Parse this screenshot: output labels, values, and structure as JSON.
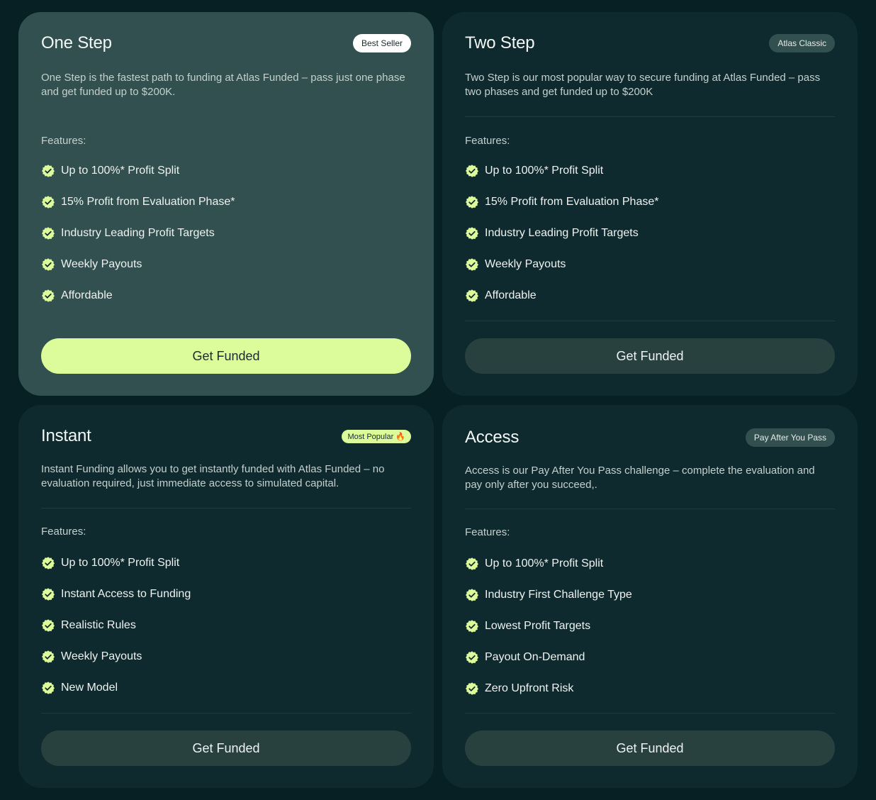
{
  "colors": {
    "background": "#062024",
    "card": "#0f2a2e",
    "card_featured": "#31504f",
    "accent_lime": "#dcfb9b",
    "button_dark": "#28413f"
  },
  "icons": {
    "feature_check": "badge-check-icon",
    "fire": "fire-icon"
  },
  "plans": [
    {
      "title": "One Step",
      "badge": "Best Seller",
      "description": "One Step is the fastest path to funding at Atlas Funded – pass just one phase and get funded up to $200K.",
      "features_label": "Features:",
      "features": [
        "Up to 100%* Profit Split",
        "15% Profit from Evaluation Phase*",
        "Industry Leading Profit Targets",
        "Weekly Payouts",
        "Affordable"
      ],
      "cta": "Get Funded"
    },
    {
      "title": "Two Step",
      "badge": "Atlas Classic",
      "description": "Two Step is our most popular way to secure funding at Atlas Funded – pass two phases and get funded up to $200K",
      "features_label": "Features:",
      "features": [
        "Up to 100%* Profit Split",
        "15% Profit from Evaluation Phase*",
        "Industry Leading Profit Targets",
        "Weekly Payouts",
        "Affordable"
      ],
      "cta": "Get Funded"
    },
    {
      "title": "Instant",
      "badge": "Most Popular 🔥",
      "description": "Instant Funding allows you to get instantly funded with Atlas Funded – no evaluation required, just immediate access to simulated capital.",
      "features_label": "Features:",
      "features": [
        "Up to 100%* Profit Split",
        "Instant Access to Funding",
        "Realistic Rules",
        "Weekly Payouts",
        "New Model"
      ],
      "cta": "Get Funded"
    },
    {
      "title": "Access",
      "badge": "Pay After You Pass",
      "description": "Access is our Pay After You Pass challenge – complete the evaluation and pay only after you succeed,.",
      "features_label": "Features:",
      "features": [
        "Up to 100%* Profit Split",
        "Industry First Challenge Type",
        "Lowest Profit Targets",
        "Payout On-Demand",
        "Zero Upfront Risk"
      ],
      "cta": "Get Funded"
    }
  ]
}
